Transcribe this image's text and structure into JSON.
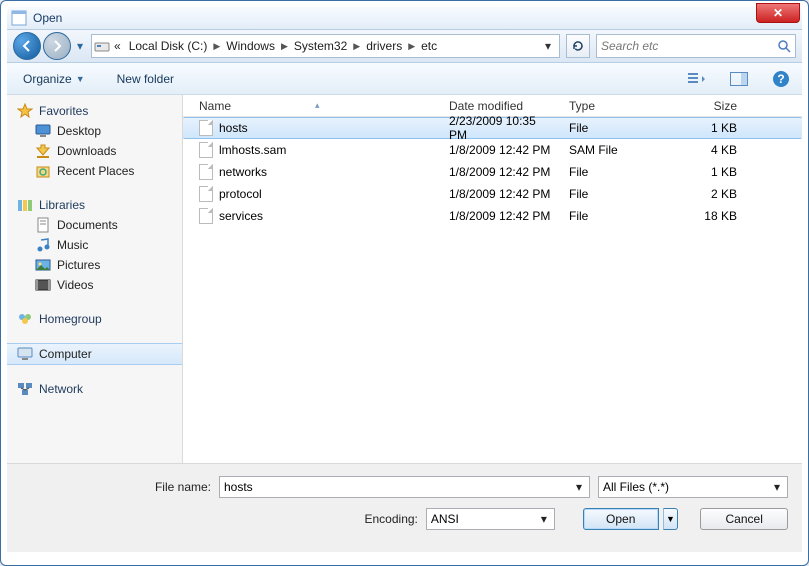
{
  "window": {
    "title": "Open"
  },
  "nav": {
    "crumbs": [
      "Local Disk (C:)",
      "Windows",
      "System32",
      "drivers",
      "etc"
    ],
    "search_placeholder": "Search etc"
  },
  "toolbar": {
    "organize": "Organize",
    "newfolder": "New folder"
  },
  "sidebar": {
    "favorites": {
      "label": "Favorites",
      "items": [
        "Desktop",
        "Downloads",
        "Recent Places"
      ]
    },
    "libraries": {
      "label": "Libraries",
      "items": [
        "Documents",
        "Music",
        "Pictures",
        "Videos"
      ]
    },
    "homegroup": {
      "label": "Homegroup"
    },
    "computer": {
      "label": "Computer",
      "selected": true
    },
    "network": {
      "label": "Network"
    }
  },
  "columns": {
    "name": "Name",
    "date": "Date modified",
    "type": "Type",
    "size": "Size"
  },
  "files": [
    {
      "name": "hosts",
      "date": "2/23/2009 10:35 PM",
      "type": "File",
      "size": "1 KB",
      "selected": true
    },
    {
      "name": "lmhosts.sam",
      "date": "1/8/2009 12:42 PM",
      "type": "SAM File",
      "size": "4 KB"
    },
    {
      "name": "networks",
      "date": "1/8/2009 12:42 PM",
      "type": "File",
      "size": "1 KB"
    },
    {
      "name": "protocol",
      "date": "1/8/2009 12:42 PM",
      "type": "File",
      "size": "2 KB"
    },
    {
      "name": "services",
      "date": "1/8/2009 12:42 PM",
      "type": "File",
      "size": "18 KB"
    }
  ],
  "bottom": {
    "filename_label": "File name:",
    "filename_value": "hosts",
    "filter": "All Files  (*.*)",
    "encoding_label": "Encoding:",
    "encoding_value": "ANSI",
    "open": "Open",
    "cancel": "Cancel"
  }
}
